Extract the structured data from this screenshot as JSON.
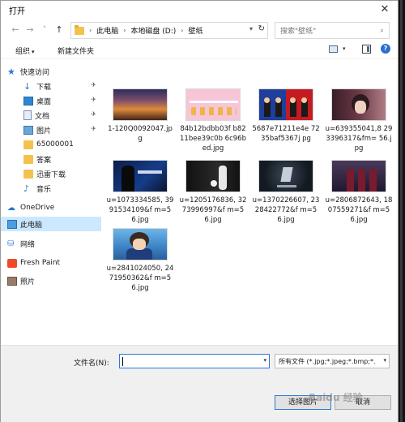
{
  "window": {
    "title": "打开",
    "close_glyph": "✕"
  },
  "nav": {
    "back_glyph": "←",
    "forward_glyph": "→",
    "history_glyph": "˅",
    "up_glyph": "↑",
    "breadcrumbs": [
      "此电脑",
      "本地磁盘 (D:)",
      "壁纸"
    ],
    "separator": "›",
    "search_placeholder": "搜索\"壁纸\""
  },
  "toolbar": {
    "organize_label": "组织",
    "new_folder_label": "新建文件夹"
  },
  "sidebar": {
    "items": [
      {
        "label": "快速访问",
        "icon": "star-icon"
      },
      {
        "label": "下载",
        "icon": "download-icon",
        "pinned": true
      },
      {
        "label": "桌面",
        "icon": "desktop-icon",
        "pinned": true
      },
      {
        "label": "文档",
        "icon": "document-icon",
        "pinned": true
      },
      {
        "label": "图片",
        "icon": "picture-icon",
        "pinned": true
      },
      {
        "label": "65000001",
        "icon": "folder-icon"
      },
      {
        "label": "答案",
        "icon": "folder-icon"
      },
      {
        "label": "迅雷下载",
        "icon": "folder-icon"
      },
      {
        "label": "音乐",
        "icon": "music-icon"
      },
      {
        "label": "OneDrive",
        "icon": "cloud-icon"
      },
      {
        "label": "此电脑",
        "icon": "computer-icon",
        "selected": true
      },
      {
        "label": "网络",
        "icon": "network-icon"
      },
      {
        "label": "Fresh Paint",
        "icon": "fresh-paint-icon"
      },
      {
        "label": "照片",
        "icon": "photos-icon"
      }
    ]
  },
  "files": [
    {
      "name": "1-120Q0092047.jpg"
    },
    {
      "name": "84b12bdbb03f b8211bee39c0b 6c96bed.jpg"
    },
    {
      "name": "5687e71211e4e 7235baf5367j pg"
    },
    {
      "name": "u=639355041,8 293396317&fm= 56.jpg"
    },
    {
      "name": "u=1073334585, 3991534109&f m=56.jpg"
    },
    {
      "name": "u=1205176836, 3273996997&f m=56.jpg"
    },
    {
      "name": "u=1370226607, 2328422772&f m=56.jpg"
    },
    {
      "name": "u=2806872643, 1807559271&f m=56.jpg"
    },
    {
      "name": "u=2841024050, 2471950362&f m=56.jpg"
    }
  ],
  "footer": {
    "filename_label": "文件名(N):",
    "filename_value": "",
    "filter_value": "所有文件 (*.jpg;*.jpeg;*.bmp;*.",
    "open_label": "选择图片",
    "cancel_label": "取消",
    "watermark": "Baidu 经验"
  },
  "colors": {
    "accent": "#2a7ad6",
    "selection": "#cce8ff"
  }
}
